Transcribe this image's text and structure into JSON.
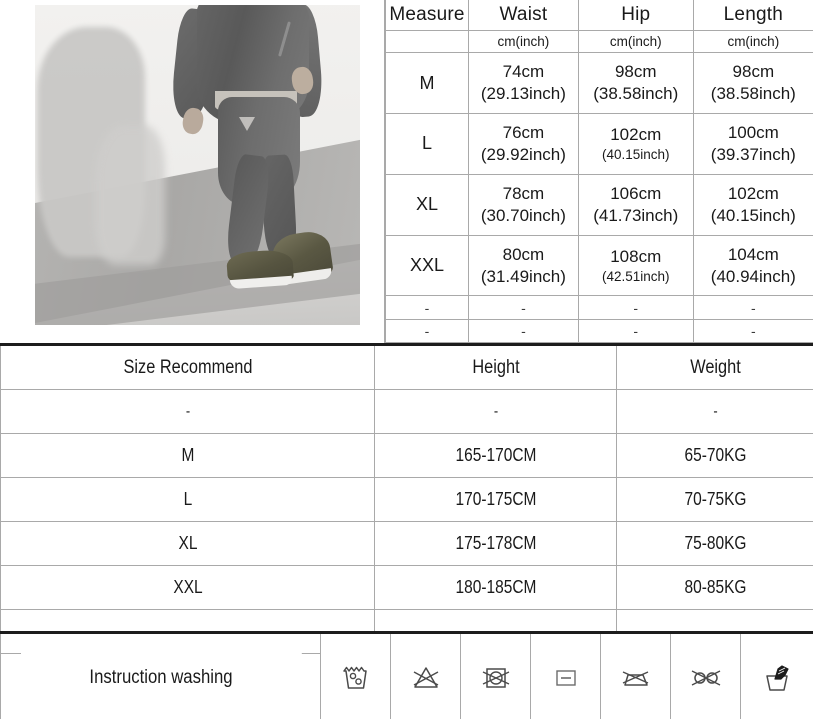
{
  "product_photo": {
    "alt": "man-wearing-grey-tracksuit-photo"
  },
  "measure_table": {
    "headers": [
      "Measure",
      "Waist",
      "Hip",
      "Length"
    ],
    "unit_row": [
      "",
      "cm(inch)",
      "cm(inch)",
      "cm(inch)"
    ],
    "rows": [
      {
        "size": "M",
        "waist_cm": "74cm",
        "waist_inch": "(29.13inch)",
        "waist_inch_small": false,
        "hip_cm": "98cm",
        "hip_inch": "(38.58inch)",
        "hip_inch_small": false,
        "length_cm": "98cm",
        "length_inch": "(38.58inch)",
        "length_inch_small": false
      },
      {
        "size": "L",
        "waist_cm": "76cm",
        "waist_inch": "(29.92inch)",
        "waist_inch_small": false,
        "hip_cm": "102cm",
        "hip_inch": "(40.15inch)",
        "hip_inch_small": true,
        "length_cm": "100cm",
        "length_inch": "(39.37inch)",
        "length_inch_small": false
      },
      {
        "size": "XL",
        "waist_cm": "78cm",
        "waist_inch": "(30.70inch)",
        "waist_inch_small": false,
        "hip_cm": "106cm",
        "hip_inch": "(41.73inch)",
        "hip_inch_small": false,
        "length_cm": "102cm",
        "length_inch": "(40.15inch)",
        "length_inch_small": false
      },
      {
        "size": "XXL",
        "waist_cm": "80cm",
        "waist_inch": "(31.49inch)",
        "waist_inch_small": false,
        "hip_cm": "108cm",
        "hip_inch": "(42.51inch)",
        "hip_inch_small": true,
        "length_cm": "104cm",
        "length_inch": "(40.94inch)",
        "length_inch_small": false
      }
    ],
    "empty_rows": [
      [
        "-",
        "-",
        "-",
        "-"
      ],
      [
        "-",
        "-",
        "-",
        "-"
      ]
    ]
  },
  "recommend_table": {
    "headers": [
      "Size Recommend",
      "Height",
      "Weight"
    ],
    "rows": [
      [
        "-",
        "-",
        "-"
      ],
      [
        "M",
        "165-170CM",
        "65-70KG"
      ],
      [
        "L",
        "170-175CM",
        "70-75KG"
      ],
      [
        "XL",
        "175-178CM",
        "75-80KG"
      ],
      [
        "XXL",
        "180-185CM",
        "80-85KG"
      ],
      [
        "-",
        "-",
        "-"
      ]
    ]
  },
  "washing": {
    "label": "Instruction washing",
    "icons": [
      "machine-wash-tub-icon",
      "do-not-bleach-icon",
      "do-not-tumble-dry-icon",
      "dry-flat-icon",
      "do-not-iron-icon",
      "do-not-dry-clean-icon",
      "hand-wash-icon"
    ]
  },
  "colors": {
    "border": "#a9a9a9",
    "heavy_border": "#1c1c1c",
    "text": "#1a1a1a",
    "background": "#ffffff"
  }
}
